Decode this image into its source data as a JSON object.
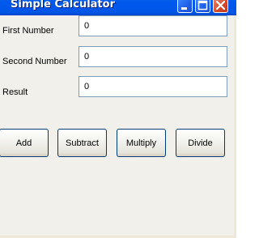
{
  "window": {
    "title": "Simple Calculator"
  },
  "controls": {
    "minimize_icon": "minimize-icon",
    "maximize_icon": "maximize-icon",
    "close_icon": "close-icon"
  },
  "fields": {
    "first": {
      "label": "First Number",
      "value": "0"
    },
    "second": {
      "label": "Second Number",
      "value": "0"
    },
    "result": {
      "label": "Result",
      "value": "0"
    }
  },
  "buttons": {
    "add": "Add",
    "subtract": "Subtract",
    "multiply": "Multiply",
    "divide": "Divide"
  },
  "colors": {
    "titlebar": "#0055e5",
    "close_button": "#d2482a",
    "window_bg": "#f1f0ea",
    "input_border": "#7f9db9",
    "button_border": "#003c74"
  }
}
